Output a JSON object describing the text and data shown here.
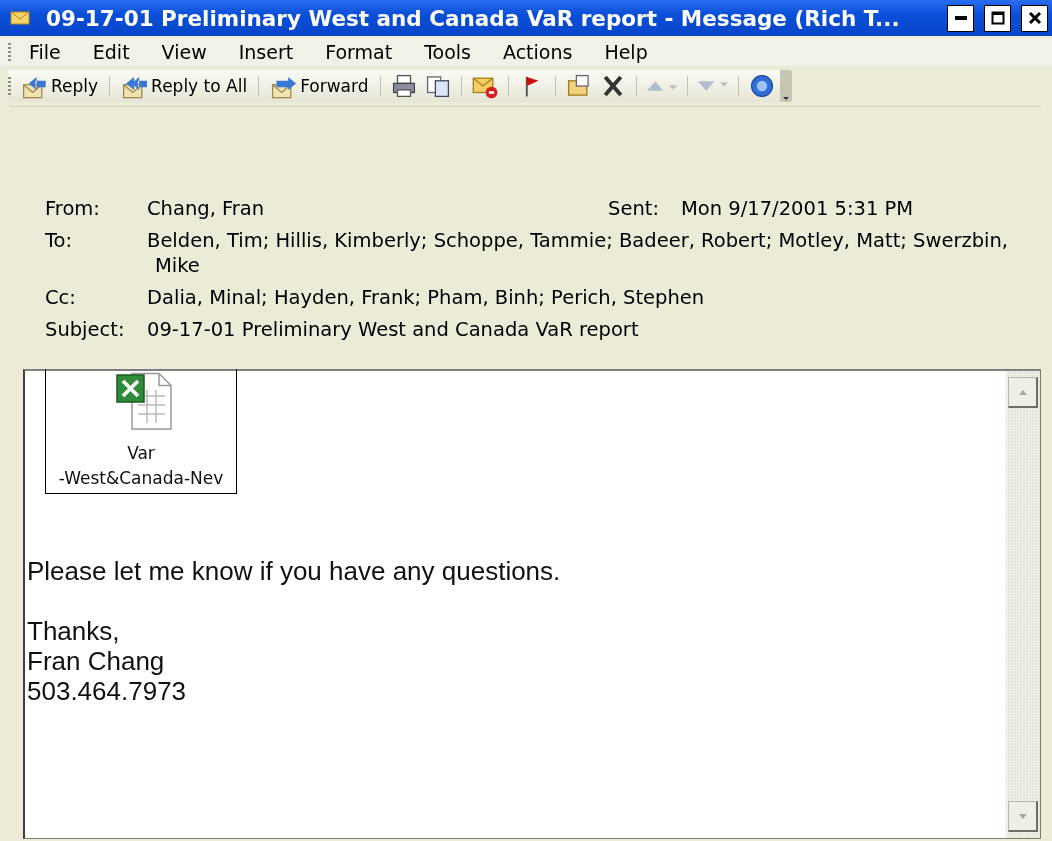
{
  "window": {
    "title": "09-17-01 Preliminary West and Canada VaR report - Message (Rich T..."
  },
  "menu": [
    "File",
    "Edit",
    "View",
    "Insert",
    "Format",
    "Tools",
    "Actions",
    "Help"
  ],
  "toolbar": {
    "buttons": [
      {
        "label": "Reply"
      },
      {
        "label": "Reply to All"
      },
      {
        "label": "Forward"
      }
    ],
    "navigation": [
      {
        "disabled": true
      },
      {
        "disabled": true
      }
    ]
  },
  "header": {
    "fields": [
      {
        "label": "From:",
        "value": "Chang, Fran"
      },
      {
        "label": "To:",
        "value": "Belden, Tim; Hillis, Kimberly; Schoppe, Tammie; Badeer, Robert; Motley, Matt; Swerzbin, Mike"
      },
      {
        "label": "Cc:",
        "value": "Dalia, Minal; Hayden, Frank; Pham, Binh; Perich, Stephen"
      },
      {
        "label": "Subject:",
        "value": "09-17-01 Preliminary West and Canada VaR report"
      }
    ],
    "sent": {
      "label": "Sent:",
      "value": "Mon 9/17/2001 5:31 PM"
    }
  },
  "body": {
    "attachment": {
      "lines": [
        "Var",
        "-West&Canada-Nev"
      ]
    },
    "paragraphs": [
      [
        "Please let me know if you have any questions."
      ],
      [
        "Thanks,",
        "Fran Chang",
        "503.464.7973"
      ]
    ]
  }
}
